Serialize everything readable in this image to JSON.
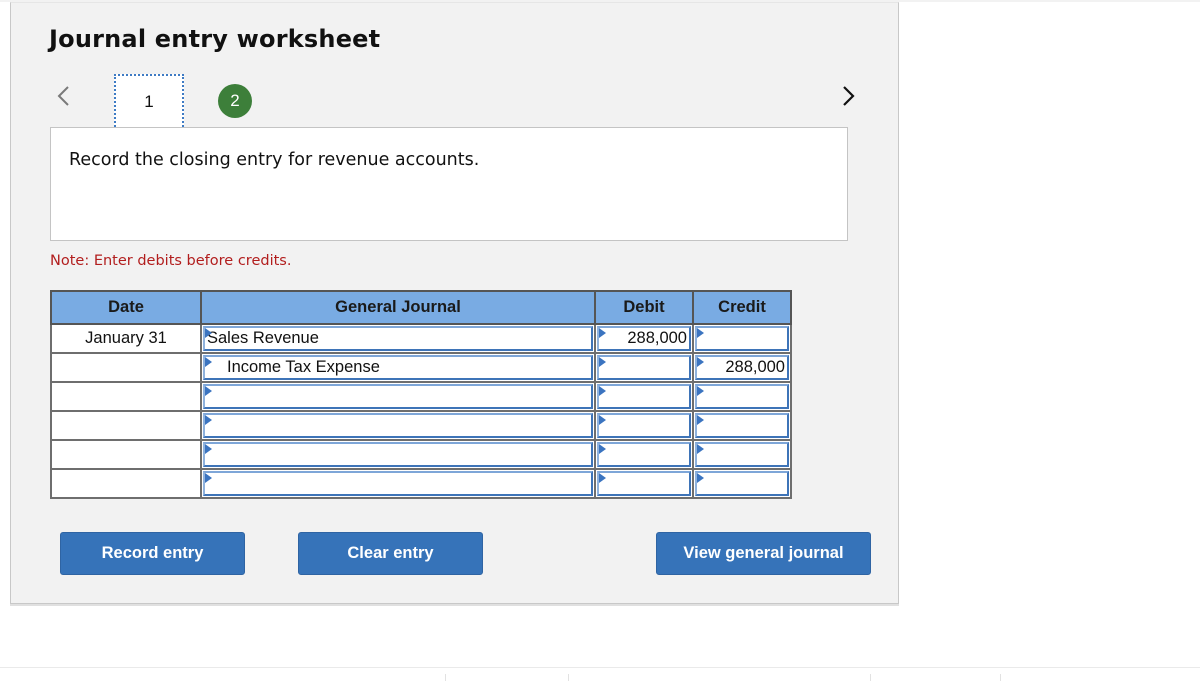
{
  "worksheet": {
    "title": "Journal entry worksheet",
    "steps": [
      {
        "label": "1",
        "state": "current"
      },
      {
        "label": "2",
        "state": "completed"
      }
    ],
    "nav": {
      "prev_icon": "chevron-left-icon",
      "next_icon": "chevron-right-icon"
    },
    "instruction": "Record the closing entry for revenue accounts.",
    "note": "Note: Enter debits before credits."
  },
  "table": {
    "headers": {
      "date": "Date",
      "general_journal": "General Journal",
      "debit": "Debit",
      "credit": "Credit"
    },
    "rows": [
      {
        "date": "January 31",
        "account": "Sales Revenue",
        "indent": false,
        "debit": "288,000",
        "credit": ""
      },
      {
        "date": "",
        "account": "Income Tax Expense",
        "indent": true,
        "debit": "",
        "credit": "288,000"
      },
      {
        "date": "",
        "account": "",
        "indent": false,
        "debit": "",
        "credit": ""
      },
      {
        "date": "",
        "account": "",
        "indent": false,
        "debit": "",
        "credit": ""
      },
      {
        "date": "",
        "account": "",
        "indent": false,
        "debit": "",
        "credit": ""
      },
      {
        "date": "",
        "account": "",
        "indent": false,
        "debit": "",
        "credit": ""
      }
    ]
  },
  "buttons": {
    "record": "Record entry",
    "clear": "Clear entry",
    "view": "View general journal"
  },
  "colors": {
    "header_blue": "#79abe3",
    "button_blue": "#3673b9",
    "step_green": "#3d7f3a",
    "note_red": "#b21e1e"
  }
}
